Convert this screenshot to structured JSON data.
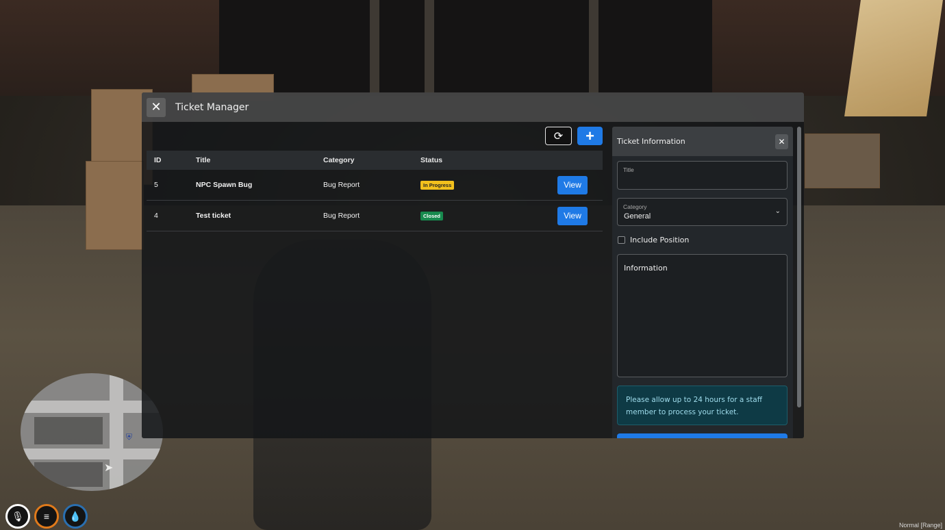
{
  "window": {
    "title": "Ticket Manager"
  },
  "table": {
    "headers": [
      "ID",
      "Title",
      "Category",
      "Status"
    ],
    "rows": [
      {
        "id": "5",
        "title": "NPC Spawn Bug",
        "category": "Bug Report",
        "status": "In Progress",
        "action": "View"
      },
      {
        "id": "4",
        "title": "Test ticket",
        "category": "Bug Report",
        "status": "Closed",
        "action": "View"
      }
    ]
  },
  "panel": {
    "title": "Ticket Information",
    "title_field_label": "Title",
    "category_label": "Category",
    "category_value": "General",
    "include_position_label": "Include Position",
    "information_placeholder": "Information",
    "notice": "Please allow up to 24 hours for a staff member to process your ticket."
  },
  "status_colors": {
    "In Progress": "#f2c01d",
    "Closed": "#178a4e"
  },
  "accent_color": "#1f7ae6",
  "icons": {
    "close": "close-icon",
    "refresh": "refresh-icon",
    "add": "plus-icon",
    "chevron": "chevron-down-icon"
  },
  "hud": {
    "corner_text": "Normal [Range]"
  }
}
